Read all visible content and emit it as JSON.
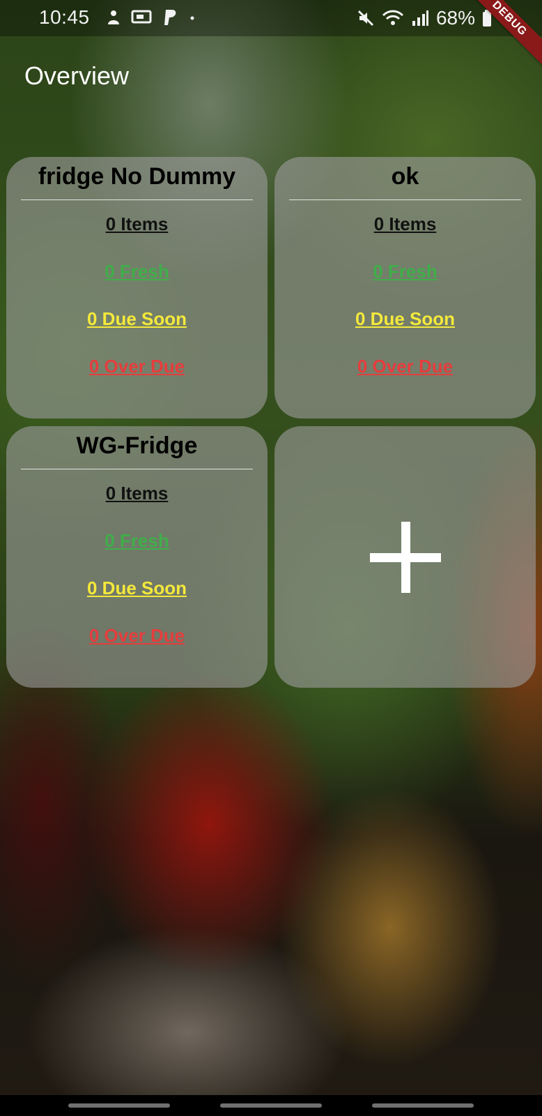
{
  "status_bar": {
    "time": "10:45",
    "battery": "68%",
    "icons_left": [
      "notification-icon",
      "cast-icon",
      "paypal-icon",
      "dot-icon"
    ],
    "icons_right": [
      "mute-icon",
      "wifi-icon",
      "signal-icon",
      "battery-icon"
    ]
  },
  "debug_banner": "DEBUG",
  "header": {
    "title": "Overview"
  },
  "cards": [
    {
      "title": "fridge No Dummy",
      "items": "0 Items",
      "fresh": "0 Fresh",
      "due_soon": "0 Due Soon",
      "over_due": "0 Over Due"
    },
    {
      "title": "ok",
      "items": "0 Items",
      "fresh": "0 Fresh",
      "due_soon": "0 Due Soon",
      "over_due": "0 Over Due"
    },
    {
      "title": "WG-Fridge",
      "items": "0 Items",
      "fresh": "0 Fresh",
      "due_soon": "0 Due Soon",
      "over_due": "0 Over Due"
    }
  ],
  "add_card": {
    "icon": "plus-icon"
  },
  "colors": {
    "fresh": "#3fae49",
    "due_soon": "#f4e93b",
    "over_due": "#e53d3d",
    "items": "#111111",
    "debug": "#8a1a1a"
  }
}
